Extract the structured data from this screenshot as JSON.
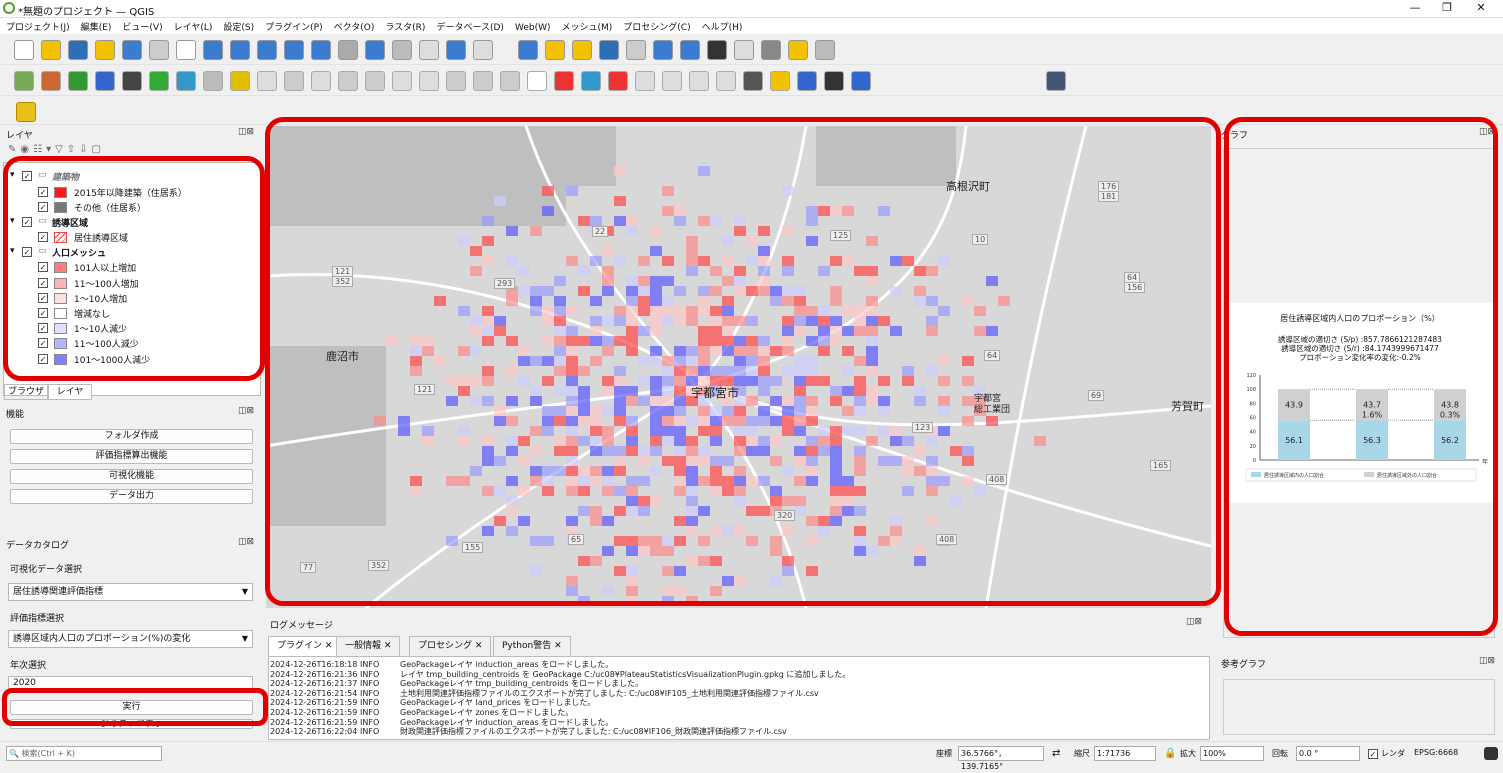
{
  "app": {
    "title": "*無題のプロジェクト — QGIS"
  },
  "menu": [
    "プロジェクト(J)",
    "編集(E)",
    "ビュー(V)",
    "レイヤ(L)",
    "設定(S)",
    "プラグイン(P)",
    "ベクタ(O)",
    "ラスタ(R)",
    "データベース(D)",
    "Web(W)",
    "メッシュ(M)",
    "プロセシング(C)",
    "ヘルプ(H)"
  ],
  "layers_panel": {
    "title": "レイヤ",
    "items": [
      {
        "label": "建築物",
        "group": true,
        "italic": true
      },
      {
        "label": "2015年以降建築（住居系）",
        "color": "#ff1a1a"
      },
      {
        "label": "その他（住居系）",
        "color": "#777777"
      },
      {
        "label": "誘導区域",
        "group": true
      },
      {
        "label": "居住誘導区域",
        "color": "hatch"
      },
      {
        "label": "人口メッシュ",
        "group": true
      },
      {
        "label": "101人以上増加",
        "color": "#ff7f7f"
      },
      {
        "label": "11〜100人増加",
        "color": "#ffb3b3"
      },
      {
        "label": "1〜10人増加",
        "color": "#ffe0e0"
      },
      {
        "label": "増減なし",
        "color": "#ffffff"
      },
      {
        "label": "1〜10人減少",
        "color": "#e0e0ff"
      },
      {
        "label": "11〜100人減少",
        "color": "#b3b3ff"
      },
      {
        "label": "101〜1000人減少",
        "color": "#7f7fff"
      }
    ],
    "tabs": [
      "ブラウザ",
      "レイヤ"
    ]
  },
  "functions_panel": {
    "title": "機能",
    "buttons": [
      "フォルダ作成",
      "評価指標算出機能",
      "可視化機能",
      "データ出力"
    ]
  },
  "catalog_panel": {
    "title": "データカタログ",
    "viz_label": "可視化データ選択",
    "viz_value": "居住誘導関連評価指標",
    "index_label": "評価指標選択",
    "index_value": "誘導区域内人口のプロポーション(%)の変化",
    "year_label": "年次選択",
    "year_value": "2020",
    "run_button": "実行",
    "ref_button": "参考グラフ表示"
  },
  "map": {
    "labels": [
      "高根沢町",
      "鹿沼市",
      "宇都宮市",
      "芳賀町",
      "宇都宮",
      "総工業団"
    ],
    "shields": [
      "176",
      "181",
      "121",
      "352",
      "293",
      "22",
      "125",
      "10",
      "64",
      "156",
      "121",
      "69",
      "123",
      "155",
      "320",
      "408",
      "165",
      "352",
      "77",
      "64",
      "65",
      "408"
    ]
  },
  "graph_panel": {
    "title": "グラフ",
    "chart_data": {
      "type": "bar",
      "title": "居住誘導区域内人口のプロポーション（%）",
      "subtitle_lines": [
        "誘導区域の適切さ (S/p) :857.7866121287483",
        "誘導区域の適切さ (S/r) :84.1743999671477",
        "プロポーション変化率の変化:-0.2%"
      ],
      "xlabel": "年",
      "ylim": [
        0,
        120
      ],
      "yticks": [
        0,
        20,
        40,
        60,
        80,
        100,
        120
      ],
      "categories": [
        "",
        "",
        ""
      ],
      "series": [
        {
          "name": "居住誘導区域内の人口割合",
          "values": [
            56.1,
            56.3,
            56.2
          ],
          "color": "#a8d8e8"
        },
        {
          "name": "居住誘導区域外の人口割合",
          "values": [
            43.9,
            43.7,
            43.8
          ],
          "color": "#d0d0d0"
        }
      ],
      "annotations": [
        "1.6%",
        "0.3%"
      ]
    }
  },
  "ref_graph_panel": {
    "title": "参考グラフ"
  },
  "log_panel": {
    "title": "ログメッセージ",
    "tabs": [
      "プラグイン",
      "一般情報",
      "プロセシング",
      "Python警告"
    ],
    "lines": [
      {
        "ts": "2024-12-26T16:18:18",
        "lv": "INFO",
        "msg": "GeoPackageレイヤ induction_areas をロードしました。"
      },
      {
        "ts": "2024-12-26T16:21:36",
        "lv": "INFO",
        "msg": "レイヤ tmp_building_centroids を GeoPackage C:/uc08¥PlateauStatisticsVisualizationPlugin.gpkg に追加しました。"
      },
      {
        "ts": "2024-12-26T16:21:37",
        "lv": "INFO",
        "msg": "GeoPackageレイヤ tmp_building_centroids をロードしました。"
      },
      {
        "ts": "2024-12-26T16:21:54",
        "lv": "INFO",
        "msg": "土地利用関連評価指標ファイルのエクスポートが完了しました: C:/uc08¥IF105_土地利用関連評価指標ファイル.csv"
      },
      {
        "ts": "2024-12-26T16:21:59",
        "lv": "INFO",
        "msg": "GeoPackageレイヤ land_prices をロードしました。"
      },
      {
        "ts": "2024-12-26T16:21:59",
        "lv": "INFO",
        "msg": "GeoPackageレイヤ zones をロードしました。"
      },
      {
        "ts": "2024-12-26T16:21:59",
        "lv": "INFO",
        "msg": "GeoPackageレイヤ induction_areas をロードしました。"
      },
      {
        "ts": "2024-12-26T16:22:04",
        "lv": "INFO",
        "msg": "財政関連評価指標ファイルのエクスポートが完了しました: C:/uc08¥IF106_財政関連評価指標ファイル.csv"
      }
    ]
  },
  "status": {
    "search_placeholder": "検索(Ctrl + K)",
    "coord_label": "座標",
    "coord_value": "36.5766°，139.7165°",
    "scale_label": "縮尺",
    "scale_value": "1:71736",
    "magnifier_label": "拡大",
    "magnifier_value": "100%",
    "rotation_label": "回転",
    "rotation_value": "0.0 °",
    "render_label": "レンダ",
    "crs": "EPSG:6668"
  }
}
